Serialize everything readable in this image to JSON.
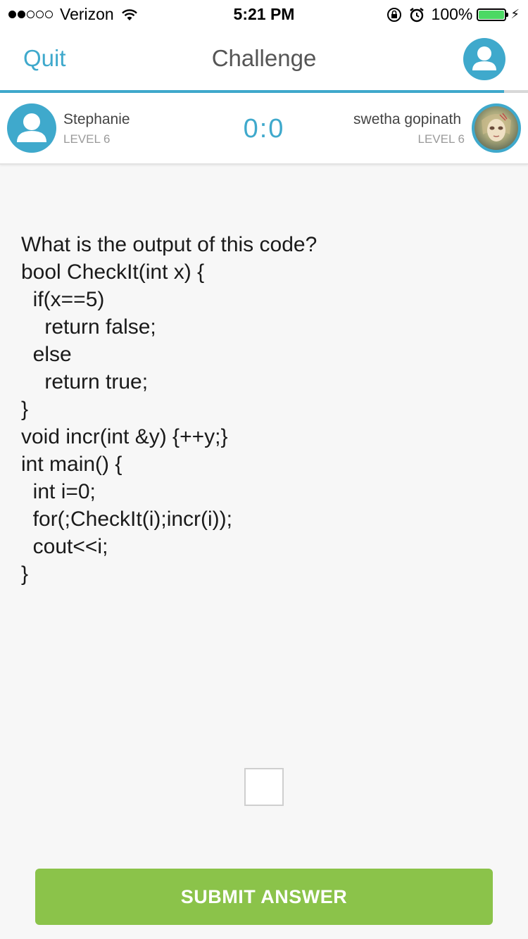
{
  "status_bar": {
    "carrier": "Verizon",
    "time": "5:21 PM",
    "battery": "100%",
    "battery_level": 1.0
  },
  "nav": {
    "quit_label": "Quit",
    "title": "Challenge",
    "progress": 0.955
  },
  "players": {
    "left": {
      "name": "Stephanie",
      "level": "LEVEL 6"
    },
    "right": {
      "name": "swetha gopinath",
      "level": "LEVEL 6"
    },
    "score": "0:0"
  },
  "question": {
    "title": "What is the output of this code?",
    "code": [
      "bool CheckIt(int x) {",
      "  if(x==5)",
      "    return false;",
      "  else",
      "    return true;",
      "}",
      "void incr(int &y) {++y;}",
      "int main() {",
      "  int i=0;",
      "  for(;CheckIt(i);incr(i));",
      "  cout<<i;",
      "}"
    ]
  },
  "answer": {
    "value": ""
  },
  "submit_label": "SUBMIT ANSWER",
  "colors": {
    "accent": "#3fa9cc",
    "submit": "#8bc34a",
    "battery": "#4cd964"
  }
}
